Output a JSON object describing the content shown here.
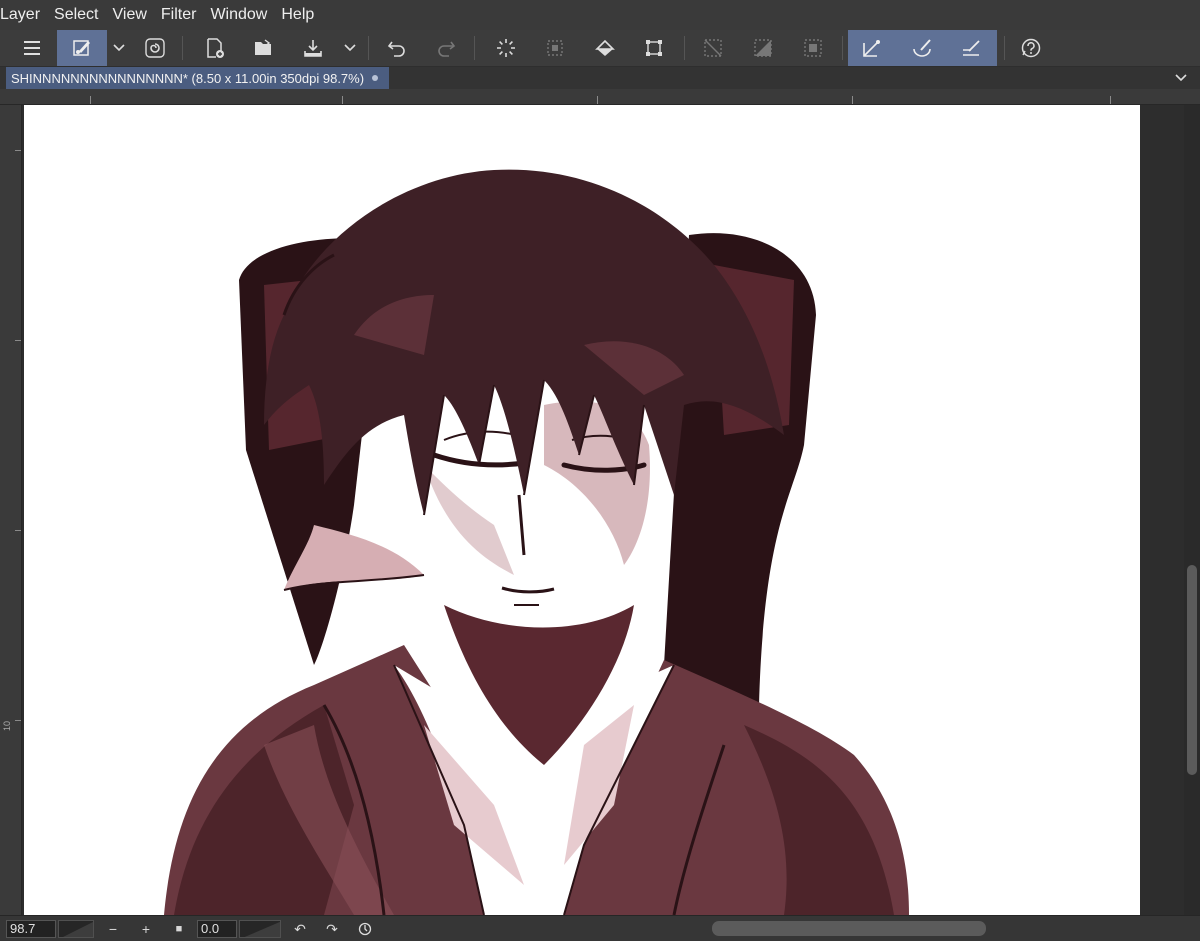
{
  "menu": {
    "items": [
      "Layer",
      "Select",
      "View",
      "Filter",
      "Window",
      "Help"
    ]
  },
  "toolbar": {
    "icons": [
      "menu-icon",
      "brush-tool-icon",
      "chevron-down-icon",
      "lasso-spiral-icon",
      "new-file-icon",
      "open-folder-icon",
      "save-download-icon",
      "chevron-down-icon",
      "undo-icon",
      "redo-icon",
      "selection-loading-icon",
      "selection-marquee-icon",
      "fill-bucket-icon",
      "transform-crop-icon",
      "clear-selection-icon",
      "invert-selection-icon",
      "show-selection-icon",
      "vector-pen-icon",
      "vector-brush-icon",
      "vector-eraser-icon",
      "help-icon"
    ],
    "selected_color": "#5f7196"
  },
  "tab": {
    "title": "SHINNNNNNNNNNNNNNNN* (8.50 x 11.00in 350dpi 98.7%)"
  },
  "ruler": {
    "left_label": "10"
  },
  "status": {
    "zoom": "98.7",
    "minus": "−",
    "plus": "+",
    "stop": "■",
    "angle": "0.0",
    "rotate_left": "↶",
    "rotate_right": "↷"
  },
  "colors": {
    "accent": "#5f7196",
    "tab_active": "#4b5d80",
    "canvas": "#ffffff",
    "ink": "#2a1216",
    "hair": "#3e2026",
    "jacket": "#6a3840",
    "skin_shadow": "#c9a0a6"
  }
}
